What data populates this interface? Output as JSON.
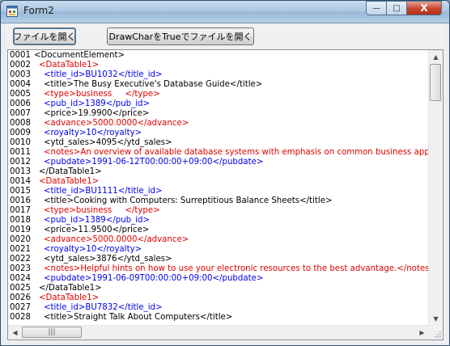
{
  "window": {
    "title": "Form2",
    "caption_buttons": {
      "minimize": "—",
      "maximize": "□",
      "close": "X"
    }
  },
  "toolbar": {
    "open_file_label": "ファイルを開く",
    "drawchar_open_label": "DrawCharをTrueでファイルを開く"
  },
  "editor": {
    "lines": [
      {
        "num": "0001",
        "indent": 0,
        "color": "black",
        "text": "<DocumentElement>"
      },
      {
        "num": "0002",
        "indent": 1,
        "color": "red",
        "text": "<DataTable1>"
      },
      {
        "num": "0003",
        "indent": 2,
        "color": "blue",
        "text": "<title_id>BU1032</title_id>"
      },
      {
        "num": "0004",
        "indent": 2,
        "color": "black",
        "text": "<title>The Busy Executive's Database Guide</title>"
      },
      {
        "num": "0005",
        "indent": 2,
        "color": "red",
        "text": "<type>business     </type>"
      },
      {
        "num": "0006",
        "indent": 2,
        "color": "blue",
        "text": "<pub_id>1389</pub_id>"
      },
      {
        "num": "0007",
        "indent": 2,
        "color": "black",
        "text": "<price>19.9900</price>"
      },
      {
        "num": "0008",
        "indent": 2,
        "color": "red",
        "text": "<advance>5000.0000</advance>"
      },
      {
        "num": "0009",
        "indent": 2,
        "color": "blue",
        "text": "<royalty>10</royalty>"
      },
      {
        "num": "0010",
        "indent": 2,
        "color": "black",
        "text": "<ytd_sales>4095</ytd_sales>"
      },
      {
        "num": "0011",
        "indent": 2,
        "color": "red",
        "text": "<notes>An overview of available database systems with emphasis on common business app"
      },
      {
        "num": "0012",
        "indent": 2,
        "color": "blue",
        "text": "<pubdate>1991-06-12T00:00:00+09:00</pubdate>"
      },
      {
        "num": "0013",
        "indent": 1,
        "color": "black",
        "text": "</DataTable1>"
      },
      {
        "num": "0014",
        "indent": 1,
        "color": "red",
        "text": "<DataTable1>"
      },
      {
        "num": "0015",
        "indent": 2,
        "color": "blue",
        "text": "<title_id>BU1111</title_id>"
      },
      {
        "num": "0016",
        "indent": 2,
        "color": "black",
        "text": "<title>Cooking with Computers: Surreptitious Balance Sheets</title>"
      },
      {
        "num": "0017",
        "indent": 2,
        "color": "red",
        "text": "<type>business     </type>"
      },
      {
        "num": "0018",
        "indent": 2,
        "color": "blue",
        "text": "<pub_id>1389</pub_id>"
      },
      {
        "num": "0019",
        "indent": 2,
        "color": "black",
        "text": "<price>11.9500</price>"
      },
      {
        "num": "0020",
        "indent": 2,
        "color": "red",
        "text": "<advance>5000.0000</advance>"
      },
      {
        "num": "0021",
        "indent": 2,
        "color": "blue",
        "text": "<royalty>10</royalty>"
      },
      {
        "num": "0022",
        "indent": 2,
        "color": "black",
        "text": "<ytd_sales>3876</ytd_sales>"
      },
      {
        "num": "0023",
        "indent": 2,
        "color": "red",
        "text": "<notes>Helpful hints on how to use your electronic resources to the best advantage.</notes"
      },
      {
        "num": "0024",
        "indent": 2,
        "color": "blue",
        "text": "<pubdate>1991-06-09T00:00:00+09:00</pubdate>"
      },
      {
        "num": "0025",
        "indent": 1,
        "color": "black",
        "text": "</DataTable1>"
      },
      {
        "num": "0026",
        "indent": 1,
        "color": "red",
        "text": "<DataTable1>"
      },
      {
        "num": "0027",
        "indent": 2,
        "color": "blue",
        "text": "<title_id>BU7832</title_id>"
      },
      {
        "num": "0028",
        "indent": 2,
        "color": "black",
        "text": "<title>Straight Talk About Computers</title>"
      }
    ]
  },
  "scrollbars": {
    "vertical_thumb_grip": "≡",
    "horizontal_thumb_grip": "|||"
  },
  "colors": {
    "red_tag": "#e00000",
    "blue_tag": "#0000ee",
    "black_text": "#000000"
  }
}
